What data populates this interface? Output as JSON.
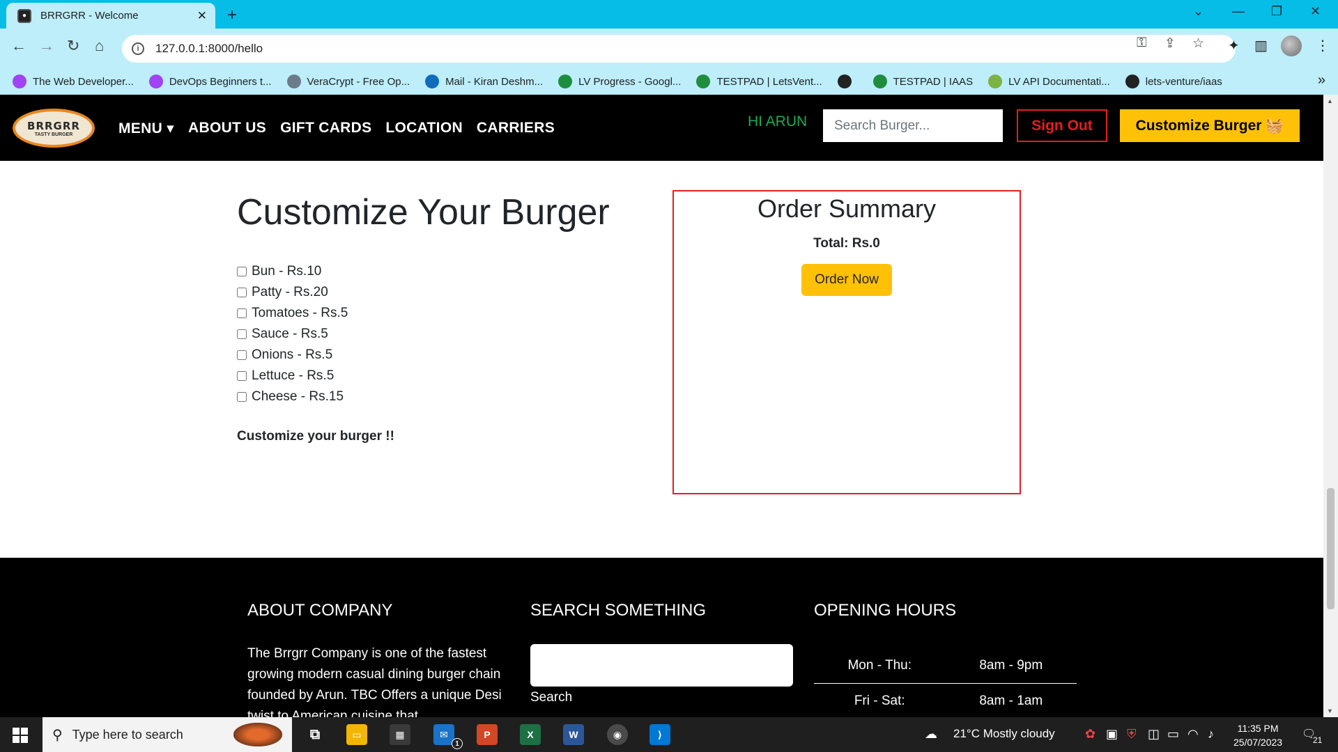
{
  "browser": {
    "tab_title": "BRRGRR - Welcome",
    "url": "127.0.0.1:8000/hello",
    "bookmarks": [
      {
        "label": "The Web Developer...",
        "color": "#a142f4"
      },
      {
        "label": "DevOps Beginners t...",
        "color": "#a142f4"
      },
      {
        "label": "VeraCrypt - Free Op...",
        "color": "#6a7b8c"
      },
      {
        "label": "Mail - Kiran Deshm...",
        "color": "#0f6cbd"
      },
      {
        "label": "LV Progress - Googl...",
        "color": "#1e8e3e"
      },
      {
        "label": "TESTPAD | LetsVent...",
        "color": "#1e8e3e"
      },
      {
        "label": "",
        "color": "#222222"
      },
      {
        "label": "TESTPAD | IAAS",
        "color": "#1e8e3e"
      },
      {
        "label": "LV API Documentati...",
        "color": "#7cb342"
      },
      {
        "label": "lets-venture/iaas",
        "color": "#222222"
      }
    ]
  },
  "nav": {
    "logo_text": "BRRGRR",
    "logo_sub": "TASTY BURGER",
    "items": [
      "MENU",
      "ABOUT US",
      "GIFT CARDS",
      "LOCATION",
      "CARRIERS"
    ],
    "greeting": "HI ARUN",
    "search_placeholder": "Search Burger...",
    "sign_out": "Sign Out",
    "customize": "Customize Burger"
  },
  "builder": {
    "title": "Customize Your Burger",
    "options": [
      "Bun - Rs.10",
      "Patty - Rs.20",
      "Tomatoes - Rs.5",
      "Sauce - Rs.5",
      "Onions - Rs.5",
      "Lettuce - Rs.5",
      "Cheese - Rs.15"
    ],
    "note": "Customize your burger !!"
  },
  "summary": {
    "title": "Order Summary",
    "total": "Total: Rs.0",
    "order_button": "Order Now"
  },
  "footer": {
    "about_title": "ABOUT COMPANY",
    "about_text": "The Brrgrr Company is one of the fastest growing modern casual dining burger chain founded by Arun. TBC Offers a unique Desi twist to American cuisine that",
    "search_title": "SEARCH SOMETHING",
    "search_button": "Search",
    "hours_title": "OPENING HOURS",
    "hours": [
      {
        "days": "Mon - Thu:",
        "time": "8am - 9pm"
      },
      {
        "days": "Fri - Sat:",
        "time": "8am - 1am"
      }
    ]
  },
  "taskbar": {
    "search_placeholder": "Type here to search",
    "weather": "21°C  Mostly cloudy",
    "time": "11:35 PM",
    "date": "25/07/2023",
    "notifications": "21",
    "mail_badge": "1"
  },
  "colors": {
    "accent": "#ffc107",
    "danger": "#e41e1e",
    "greeting": "#1eaa56",
    "browser_frame": "#06bde7"
  }
}
